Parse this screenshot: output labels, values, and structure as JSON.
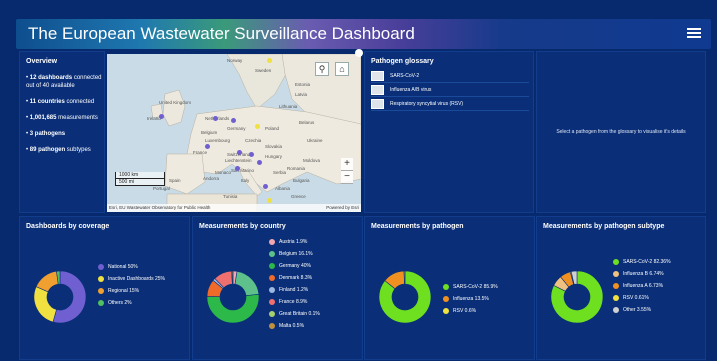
{
  "header": {
    "title": "The European Wastewater Surveillance Dashboard"
  },
  "overview": {
    "title": "Overview",
    "items": [
      {
        "bold": "12 dashboards",
        "rest": "connected out of 40 available"
      },
      {
        "bold": "11 countries",
        "rest": "connected"
      },
      {
        "bold": "1,001,685",
        "rest": "measurements"
      },
      {
        "bold": "3 pathogens",
        "rest": ""
      },
      {
        "bold": "89 pathogen",
        "rest": "subtypes"
      }
    ]
  },
  "map": {
    "labels": [
      "Norway",
      "Sweden",
      "Estonia",
      "Latvia",
      "Lithuania",
      "United Kingdom",
      "Ireland",
      "Netherlands",
      "Germany",
      "Poland",
      "Belarus",
      "Belgium",
      "Luxembourg",
      "Czechia",
      "Slovakia",
      "Ukraine",
      "France",
      "Switzerland",
      "Liechtenstein",
      "Hungary",
      "Moldova",
      "Spain",
      "Portugal",
      "San Marino",
      "Romania",
      "Italy",
      "Serbia",
      "Bulgaria",
      "Monaco",
      "Andorra",
      "Tunisia",
      "Albania",
      "Greece"
    ],
    "scale": [
      "1000 km",
      "500 mi"
    ],
    "attribution": "Esri, EU Wastewater Observatory for Public Health",
    "powered": "Powered by Esri",
    "controls": [
      "+",
      "−"
    ]
  },
  "glossary": {
    "title": "Pathogen glossary",
    "items": [
      "SARS-CoV-2",
      "Influenza A/B virus",
      "Respiratory syncytial virus (RSV)"
    ]
  },
  "hint": "Select a pathogen from the glossary to visualise it's details",
  "charts": {
    "coverage": {
      "title": "Dashboards by coverage",
      "legend": [
        "National 50%",
        "Inactive Dashboards  25%",
        "Regional 15%",
        "Others 2%"
      ]
    },
    "country": {
      "title": "Measurements by country",
      "legend": [
        "Austria 1.9%",
        "Belgium 16.1%",
        "Germany 40%",
        "Denmark 8.3%",
        "Finland 1.2%",
        "France 8.9%",
        "Great Britain 0.1%",
        "Malta 0.5%"
      ]
    },
    "pathogen": {
      "title": "Measurements by pathogen",
      "legend": [
        "SARS-CoV-2 85.9%",
        "Influenza 13.5%",
        "RSV 0.6%"
      ]
    },
    "subtype": {
      "title": "Measurements by pathogen subtype",
      "legend": [
        "SARS-CoV-2 82.36%",
        "Influenza B 6.74%",
        "Influenza A 6.73%",
        "RSV 0.61%",
        "Other 3.55%"
      ]
    }
  },
  "chart_data": [
    {
      "type": "pie",
      "title": "Dashboards by coverage",
      "categories": [
        "National",
        "Inactive Dashboards",
        "Regional",
        "Others"
      ],
      "values": [
        50,
        25,
        15,
        2
      ],
      "colors": [
        "#6f5fd0",
        "#f0e040",
        "#f0a030",
        "#50c060"
      ]
    },
    {
      "type": "pie",
      "title": "Measurements by country",
      "categories": [
        "Austria",
        "Belgium",
        "Germany",
        "Denmark",
        "Finland",
        "France",
        "Great Britain",
        "Malta"
      ],
      "values": [
        1.9,
        16.1,
        40,
        8.3,
        1.2,
        8.9,
        0.1,
        0.5
      ],
      "colors": [
        "#f4a6b0",
        "#5ec08a",
        "#2db84a",
        "#f06a2a",
        "#9ab8e0",
        "#f07070",
        "#a6d070",
        "#c09040"
      ]
    },
    {
      "type": "pie",
      "title": "Measurements by pathogen",
      "categories": [
        "SARS-CoV-2",
        "Influenza",
        "RSV"
      ],
      "values": [
        85.9,
        13.5,
        0.6
      ],
      "colors": [
        "#6ee020",
        "#f09020",
        "#f0e040"
      ]
    },
    {
      "type": "pie",
      "title": "Measurements by pathogen subtype",
      "categories": [
        "SARS-CoV-2",
        "Influenza B",
        "Influenza A",
        "RSV",
        "Other"
      ],
      "values": [
        82.36,
        6.74,
        6.73,
        0.61,
        3.55
      ],
      "colors": [
        "#6ee020",
        "#f0c080",
        "#f09020",
        "#f0e040",
        "#d0d0d0"
      ]
    }
  ]
}
